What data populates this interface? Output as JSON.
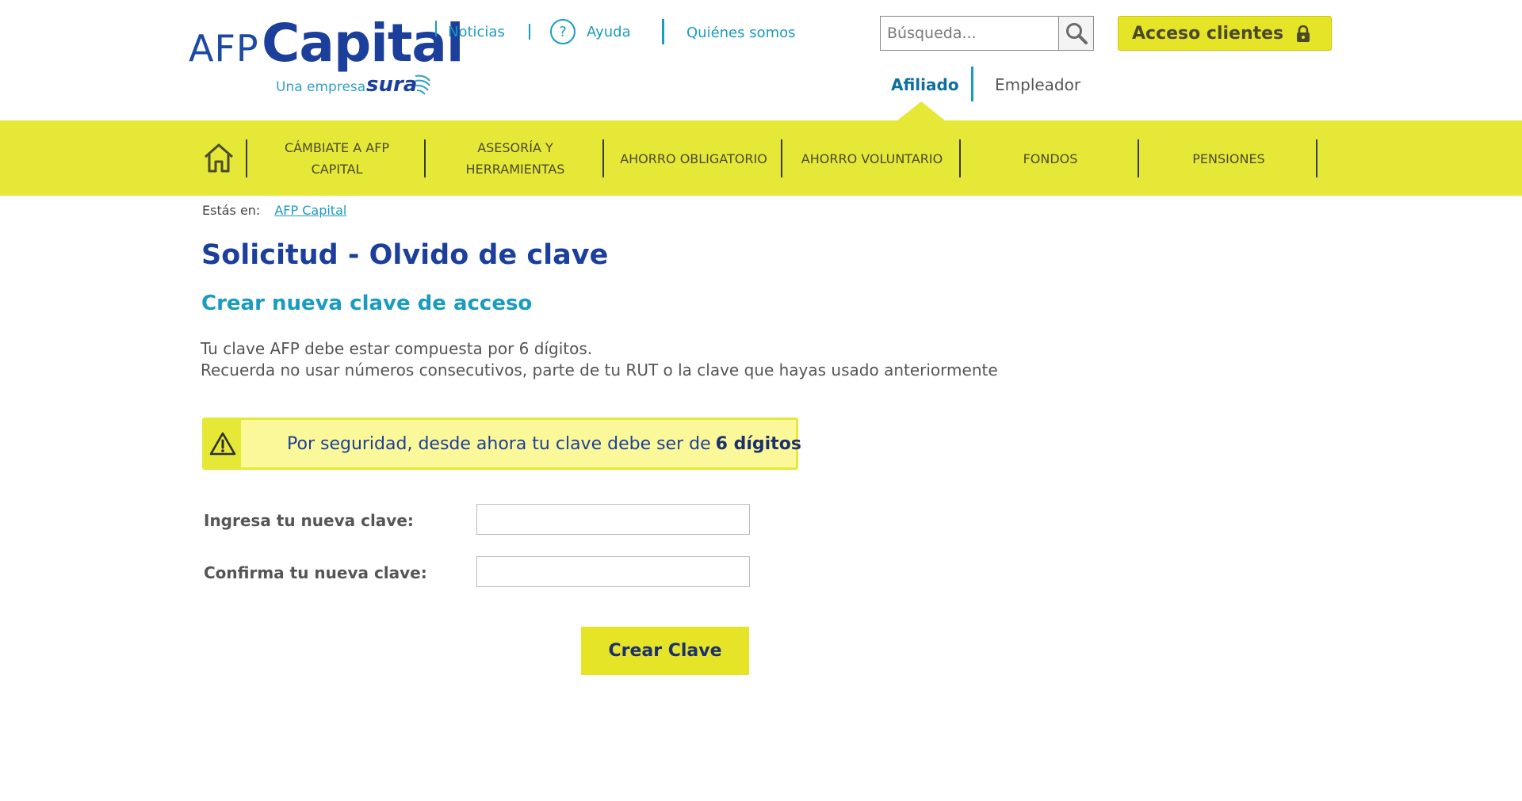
{
  "logo": {
    "afp": "AFP",
    "capital": "Capital",
    "tagline": "Una empresa",
    "partner": "sura"
  },
  "topnav": {
    "news": "Noticias",
    "help": "Ayuda",
    "help_glyph": "?",
    "about": "Quiénes somos"
  },
  "search": {
    "placeholder": "Búsqueda...",
    "value": ""
  },
  "access_button": {
    "label": "Acceso clientes",
    "icon": "lock-icon"
  },
  "user_types": {
    "affiliate": "Afiliado",
    "employer": "Empleador",
    "active": "Afiliado"
  },
  "mainnav": {
    "home_icon": "home-icon",
    "items": [
      {
        "label": "CÁMBIATE A AFP CAPITAL"
      },
      {
        "label": "ASESORÍA Y HERRAMIENTAS"
      },
      {
        "label": "AHORRO OBLIGATORIO"
      },
      {
        "label": "AHORRO VOLUNTARIO"
      },
      {
        "label": "FONDOS"
      },
      {
        "label": "PENSIONES"
      }
    ]
  },
  "breadcrumb": {
    "prefix": "Estás en:",
    "link": "AFP Capital"
  },
  "page": {
    "title": "Solicitud - Olvido de clave",
    "subtitle": "Crear nueva clave de acceso",
    "desc_line1": "Tu clave AFP debe estar compuesta por 6 dígitos.",
    "desc_line2": "Recuerda no usar números consecutivos, parte de tu RUT o la clave que hayas usado anteriormente"
  },
  "alert": {
    "icon": "warning-icon",
    "text": "Por seguridad, desde ahora tu clave debe ser de",
    "emphasis": "6 dígitos"
  },
  "form": {
    "new_label": "Ingresa tu nueva clave:",
    "new_value": "",
    "confirm_label": "Confirma tu nueva clave:",
    "confirm_value": "",
    "submit": "Crear Clave"
  },
  "colors": {
    "brand_blue": "#1c3f9c",
    "accent_cyan": "#1a9bc0",
    "brand_yellow": "#e6e838",
    "alert_bg": "#fbf89a"
  }
}
